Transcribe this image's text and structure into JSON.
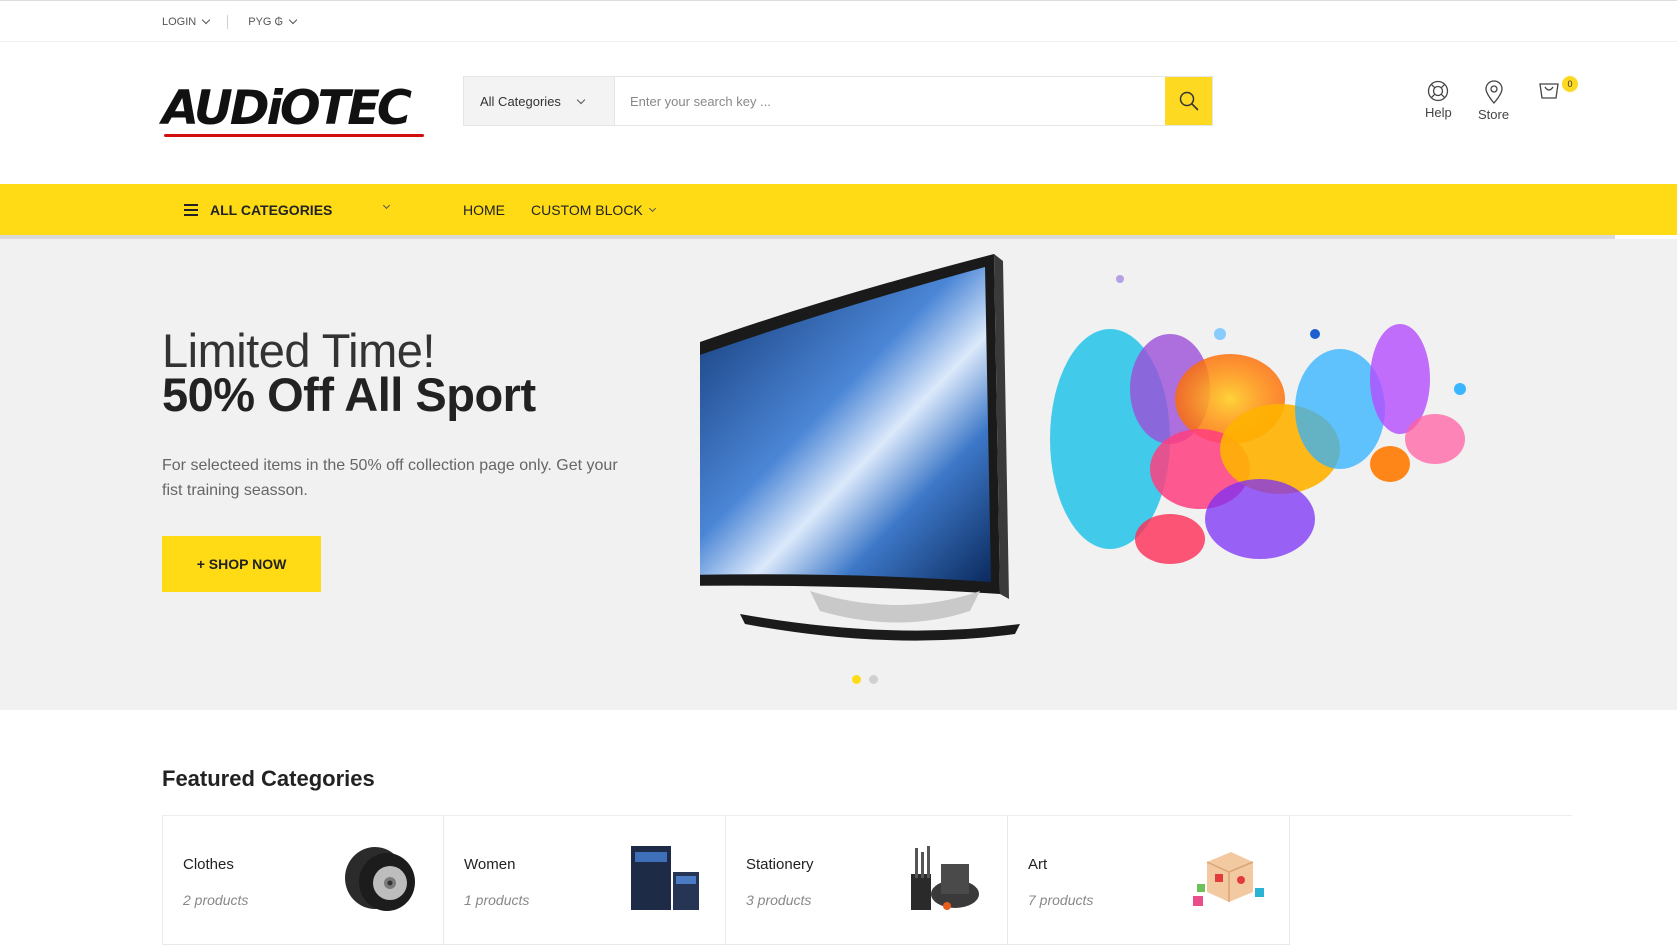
{
  "topbar": {
    "login_label": "LOGIN",
    "currency_label": "PYG ₲"
  },
  "header": {
    "logo_text": "AUDiOTEC",
    "search": {
      "category_label": "All Categories",
      "placeholder": "Enter your search key ...",
      "value": ""
    },
    "help_label": "Help",
    "store_label": "Store",
    "cart_count": "0"
  },
  "nav": {
    "all_categories_label": "ALL CATEGORIES",
    "links": [
      {
        "label": "HOME"
      },
      {
        "label": "CUSTOM BLOCK"
      }
    ]
  },
  "hero": {
    "headline_line1": "Limited Time!",
    "headline_line2": "50% Off All Sport",
    "description": "For selecteed items in the 50% off collection page only. Get your fist training seasson.",
    "cta_label": "+ SHOP NOW",
    "slide_count": 2,
    "active_slide": 1
  },
  "featured": {
    "title": "Featured Categories",
    "categories": [
      {
        "name": "Clothes",
        "count": "2 products",
        "icon": "tire-icon"
      },
      {
        "name": "Women",
        "count": "1 products",
        "icon": "books-icon"
      },
      {
        "name": "Stationery",
        "count": "3 products",
        "icon": "kitchen-tools-icon"
      },
      {
        "name": "Art",
        "count": "7 products",
        "icon": "toy-blocks-icon"
      }
    ]
  },
  "colors": {
    "accent": "#fedb14",
    "logo_underline": "#d10f0f",
    "hero_bg": "#f1f1f1"
  }
}
